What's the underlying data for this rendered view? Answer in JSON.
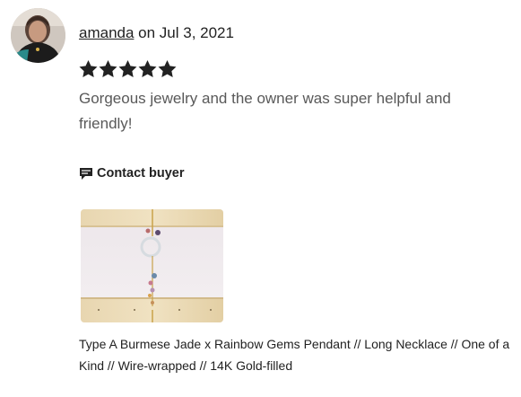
{
  "review": {
    "author": "amanda",
    "date_text": " on Jul 3, 2021",
    "rating": 5,
    "rating_max": 5,
    "text": "Gorgeous jewelry and the owner was super helpful and friendly!",
    "contact_label": "Contact buyer",
    "contact_icon": "message-icon",
    "star_color": "#222222"
  },
  "product": {
    "title": "Type A Burmese Jade x Rainbow Gems Pendant // Long Necklace // One of a Kind // Wire-wrapped // 14K Gold-filled"
  }
}
